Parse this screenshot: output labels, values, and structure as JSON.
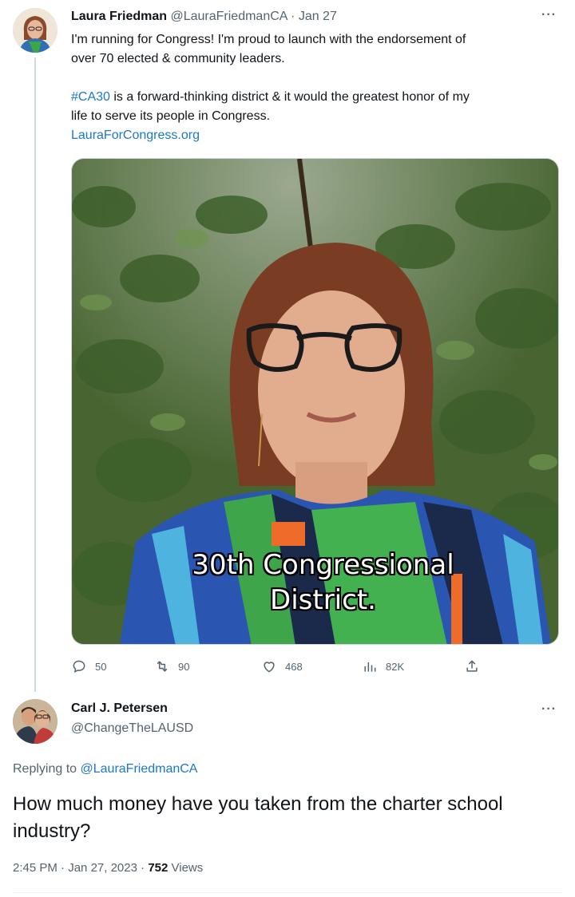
{
  "tweet1": {
    "name": "Laura Friedman",
    "handle": "@LauraFriedmanCA",
    "separator": "·",
    "date": "Jan 27",
    "more": "···",
    "text_line1": "I'm running for Congress!  I'm proud to launch with the endorsement of",
    "text_line2": "over 70 elected & community leaders.",
    "hashtag": "#CA30",
    "text_line3_rest": " is a forward-thinking district & it would the greatest honor of my",
    "text_line4": "life to serve its people in Congress.",
    "link": "LauraForCongress.org",
    "video_caption_line1": "30th Congressional",
    "video_caption_line2": "District.",
    "actions": {
      "replies": "50",
      "retweets": "90",
      "likes": "468",
      "views": "82K"
    }
  },
  "tweet2": {
    "name": "Carl J. Petersen",
    "handle": "@ChangeTheLAUSD",
    "more": "···",
    "replying_prefix": "Replying to ",
    "replying_to": "@LauraFriedmanCA",
    "text": "How much money have you taken from the charter school industry?",
    "time": "2:45 PM",
    "separator": "·",
    "date": "Jan 27, 2023",
    "views_count": "752",
    "views_label": "Views"
  },
  "colors": {
    "link": "#1d77c9",
    "muted": "#536471",
    "text": "#0f1419",
    "thread_line": "#cfd9de"
  },
  "icons": [
    "reply-icon",
    "retweet-icon",
    "like-icon",
    "views-icon",
    "share-icon",
    "more-icon"
  ]
}
